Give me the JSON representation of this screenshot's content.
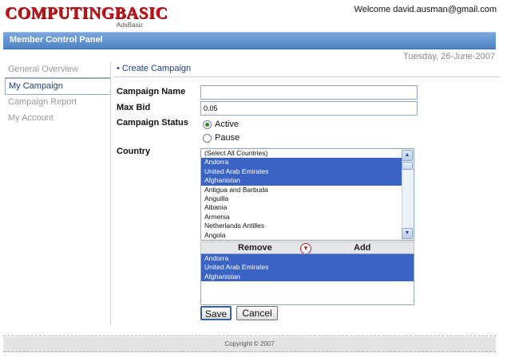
{
  "header": {
    "logo_text": "COMPUTINGBASIC",
    "logo_sub": "AdsBasic",
    "welcome": "Welcome david.ausman@gmail.com"
  },
  "panel": {
    "title": "Member Control Panel",
    "date": "Tuesday, 26-June-2007"
  },
  "sidebar": {
    "items": [
      {
        "label": "General Overview"
      },
      {
        "label": "My Campaign"
      },
      {
        "label": "Campaign Report"
      },
      {
        "label": "My Account"
      }
    ]
  },
  "breadcrumb": "• Create Campaign",
  "form": {
    "campaign_name_label": "Campaign Name",
    "campaign_name_value": "",
    "max_bid_label": "Max Bid",
    "max_bid_value": "0.05",
    "status_label": "Campaign Status",
    "status_active": "Active",
    "status_pause": "Pause",
    "country_label": "Country",
    "countries": [
      "(Select All Countries)",
      "Andorra",
      "United Arab Emirates",
      "Afghanistan",
      "Antigua and Barbuda",
      "Anguilla",
      "Albania",
      "Armenia",
      "Netherlands Antilles",
      "Angola"
    ],
    "remove_label": "Remove",
    "add_label": "Add",
    "selected": [
      "Andorra",
      "United Arab Emirates",
      "Afghanistan"
    ],
    "save_label": "Save",
    "cancel_label": "Cancel"
  },
  "footer": "Copyright © 2007",
  "colors": {
    "brand": "#c0141c",
    "bar": "#5b8fd0",
    "selection": "#3b63c4"
  },
  "icons": [
    "scroll-up-icon",
    "scroll-down-icon",
    "move-down-icon"
  ]
}
